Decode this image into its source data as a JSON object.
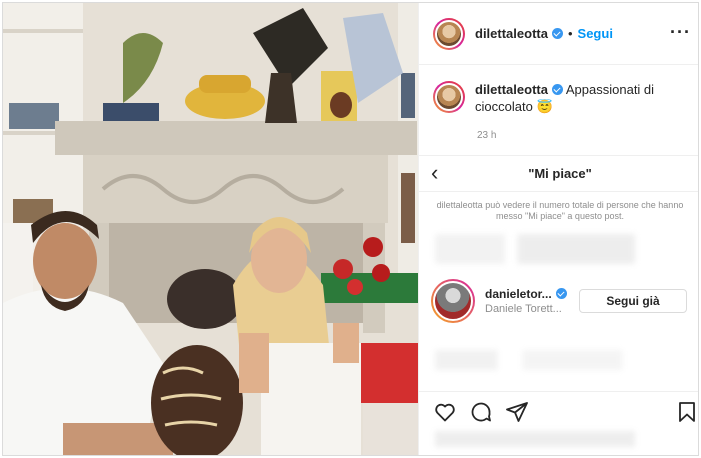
{
  "post": {
    "author": "dilettaleotta",
    "follow_label": "Segui",
    "separator": "•",
    "more_icon": "more-options-icon",
    "caption_username": "dilettaleotta",
    "caption_text": "Appassionati di cioccolato",
    "caption_emoji": "😇",
    "time": "23 h"
  },
  "likes_panel": {
    "title": "\"Mi piace\"",
    "back_icon": "chevron-left-icon",
    "back_glyph": "‹",
    "notice": "dilettaleotta può vedere il numero totale di persone che hanno messo \"Mi piace\" a questo post.",
    "likers": [
      {
        "username": "danieletor...",
        "name": "Daniele Torett...",
        "verified": true,
        "button_label": "Segui già"
      }
    ]
  },
  "actions": {
    "icons": [
      "heart-icon",
      "comment-icon",
      "share-icon",
      "bookmark-icon"
    ]
  },
  "colors": {
    "accent": "#0095f6",
    "verified": "#3897f0",
    "muted": "#8e8e8e"
  }
}
